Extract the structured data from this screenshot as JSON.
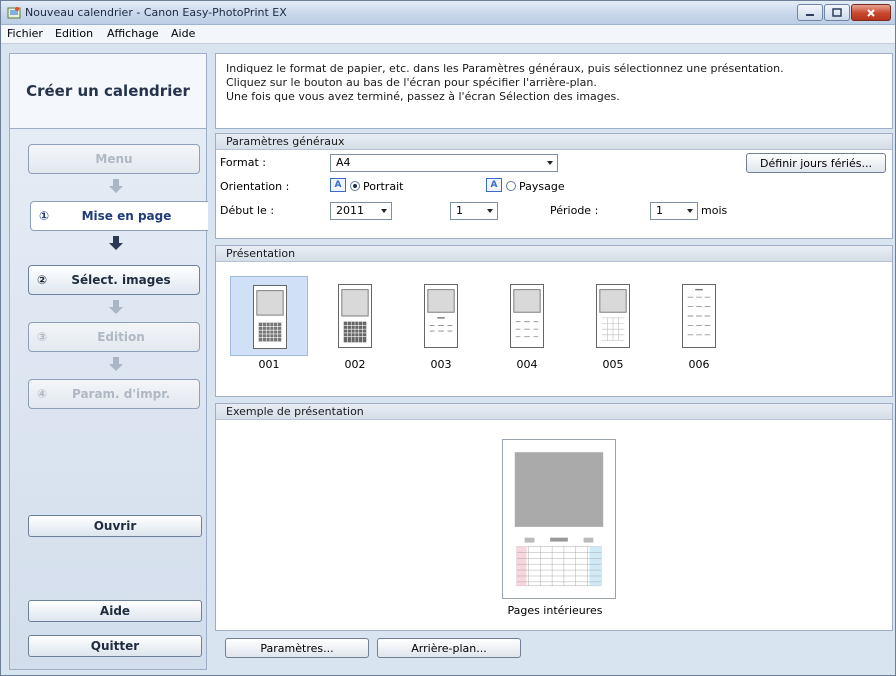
{
  "window": {
    "title": "Nouveau calendrier - Canon Easy-PhotoPrint EX",
    "controls": {
      "minimize_icon": "minimize-icon",
      "maximize_icon": "maximize-icon",
      "close_icon": "close-icon"
    }
  },
  "menubar": {
    "items": [
      "Fichier",
      "Edition",
      "Affichage",
      "Aide"
    ]
  },
  "sidebar": {
    "title": "Créer un calendrier",
    "steps": [
      {
        "num": "",
        "label": "Menu",
        "state": "disabled"
      },
      {
        "num": "①",
        "label": "Mise en page",
        "state": "active"
      },
      {
        "num": "②",
        "label": "Sélect. images",
        "state": "enabled"
      },
      {
        "num": "③",
        "label": "Edition",
        "state": "disabled"
      },
      {
        "num": "④",
        "label": "Param. d'impr.",
        "state": "disabled"
      }
    ],
    "open_label": "Ouvrir",
    "help_label": "Aide",
    "quit_label": "Quitter"
  },
  "info": {
    "line1": "Indiquez le format de papier, etc. dans les Paramètres généraux, puis sélectionnez une présentation.",
    "line2": "Cliquez sur le bouton au bas de l'écran pour spécifier l'arrière-plan.",
    "line3": "Une fois que vous avez terminé, passez à l'écran Sélection des images."
  },
  "general": {
    "heading": "Paramètres généraux",
    "format_label": "Format :",
    "format_value": "A4",
    "holidays_button": "Définir jours fériés...",
    "orientation_label": "Orientation :",
    "portrait_label": "Portrait",
    "landscape_label": "Paysage",
    "orientation_selected": "Portrait",
    "start_label": "Début le :",
    "start_year": "2011",
    "start_month": "1",
    "period_label": "Période :",
    "period_value": "1",
    "period_unit": "mois"
  },
  "presentation": {
    "heading": "Présentation",
    "layouts": [
      "001",
      "002",
      "003",
      "004",
      "005",
      "006"
    ],
    "selected": "001"
  },
  "example": {
    "heading": "Exemple de présentation",
    "caption": "Pages intérieures"
  },
  "bottom": {
    "settings_button": "Paramètres...",
    "background_button": "Arrière-plan..."
  },
  "colors": {
    "accent": "#1f3d7a",
    "selection": "#cfe0f7",
    "close": "#c9472f"
  }
}
